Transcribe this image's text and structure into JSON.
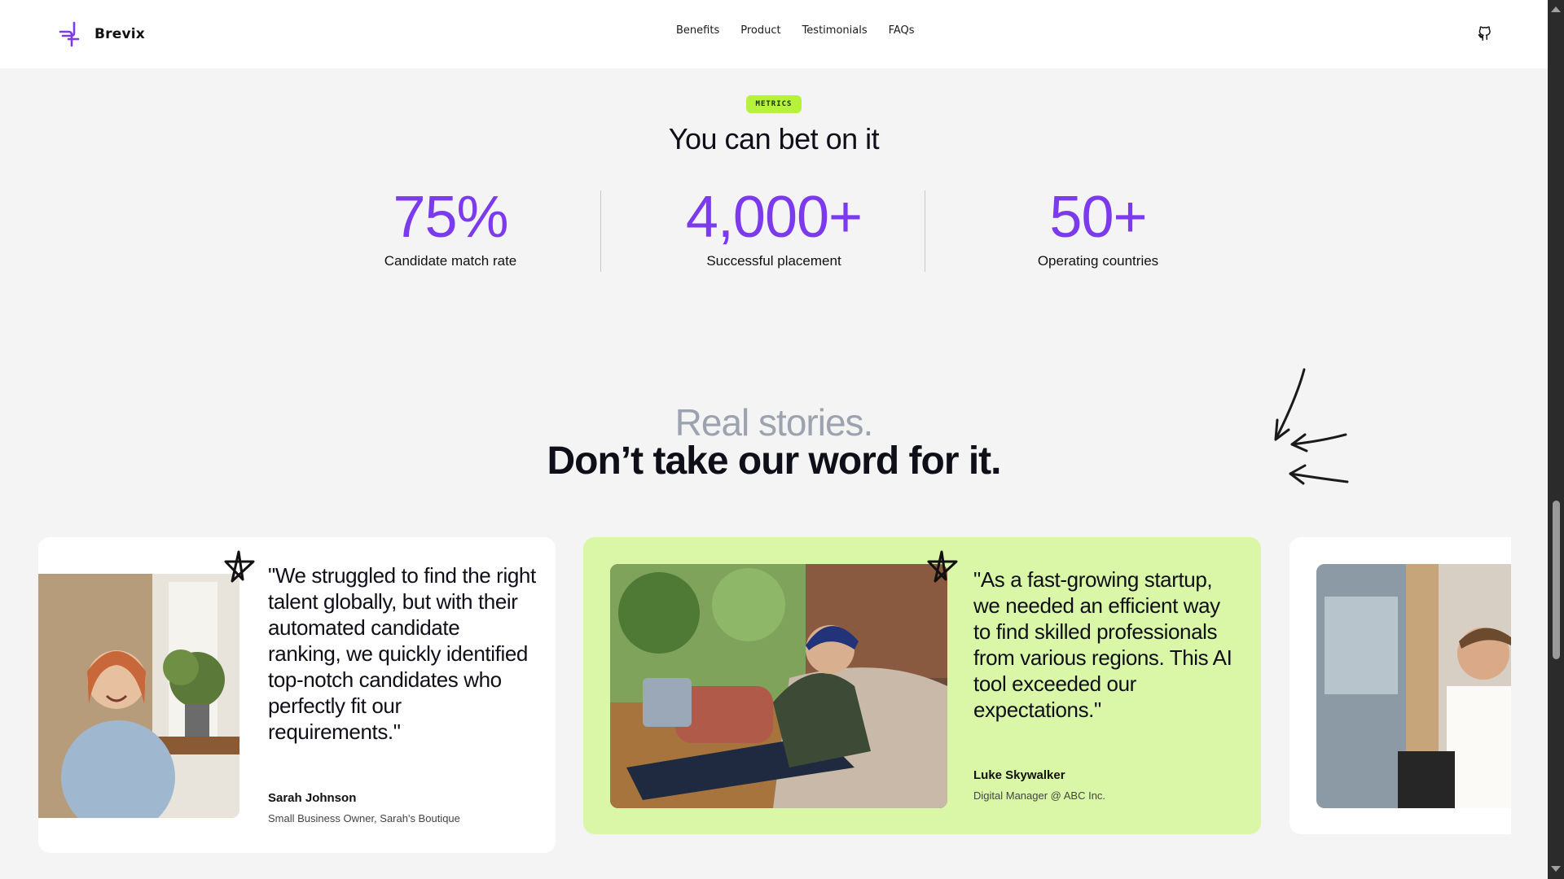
{
  "brand": {
    "name": "Brevix",
    "accent": "#7c3aed",
    "logo_icon": "brevix-logo-icon"
  },
  "nav": {
    "items": [
      "Benefits",
      "Product",
      "Testimonials",
      "FAQs"
    ],
    "github_icon": "github-icon"
  },
  "metrics": {
    "badge": "METRICS",
    "title": "You can bet on it",
    "items": [
      {
        "value": "75%",
        "label": "Candidate match rate"
      },
      {
        "value": "4,000+",
        "label": "Successful placement"
      },
      {
        "value": "50+",
        "label": "Operating countries"
      }
    ]
  },
  "stories": {
    "line1": "Real stories.",
    "line2": "Don’t take our word for it."
  },
  "testimonials": [
    {
      "quote": "\"We struggled to find the right talent globally, but with their automated candidate ranking, we quickly identified top-notch candidates who perfectly fit our requirements.\"",
      "author": "Sarah Johnson",
      "role": "Small Business Owner, Sarah's Boutique",
      "background": "#ffffff"
    },
    {
      "quote": "\"As a fast-growing startup, we needed an efficient way to find skilled professionals from various regions. This AI tool exceeded our expectations.\"",
      "author": "Luke Skywalker",
      "role": "Digital Manager @ ABC Inc.",
      "background": "#d9f7a6"
    }
  ]
}
